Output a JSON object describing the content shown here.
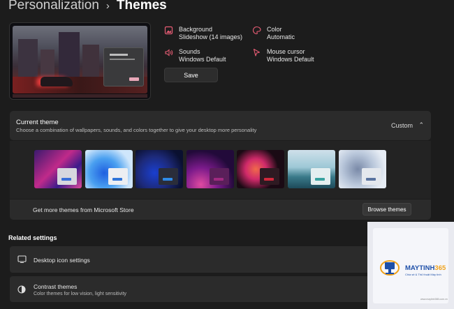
{
  "breadcrumb": {
    "parent": "Personalization",
    "separator": "›",
    "current": "Themes"
  },
  "properties": {
    "background": {
      "label": "Background",
      "value": "Slideshow (14 images)",
      "icon": "image-icon"
    },
    "color": {
      "label": "Color",
      "value": "Automatic",
      "icon": "palette-icon"
    },
    "sounds": {
      "label": "Sounds",
      "value": "Windows Default",
      "icon": "speaker-icon"
    },
    "mouse_cursor": {
      "label": "Mouse cursor",
      "value": "Windows Default",
      "icon": "cursor-icon"
    }
  },
  "save_label": "Save",
  "current_theme": {
    "title": "Current theme",
    "subtitle": "Choose a combination of wallpapers, sounds, and colors together to give your desktop more personality",
    "value": "Custom",
    "themes": [
      {
        "bg": "linear-gradient(135deg,#3a1a6e,#c02a8a 45%,#3b1b8a 70%,#e04a9a)",
        "win": "#d7d7de",
        "btn": "#3a6fd8"
      },
      {
        "bg": "radial-gradient(circle at 40% 60%,#1f5fe0,#4aa0f0 40%,#cfe6fb 75%)",
        "win": "#eceef2",
        "btn": "#2f74d8"
      },
      {
        "bg": "radial-gradient(circle at 40% 60%,#1a3fd0,#1d2a7a 45%,#0a1030 80%)",
        "win": "#2a2d3a",
        "btn": "#2f8ae8"
      },
      {
        "bg": "radial-gradient(circle at 30% 90%,#e04aa0,#7a1a8a 35%,#220a3a 70%)",
        "win": "#5a1f5a",
        "btn": "#a02a80"
      },
      {
        "bg": "radial-gradient(circle at 40% 50%,#f06a4a,#d02a6a 30%,#1a0a14 65%)",
        "win": "#2e1a22",
        "btn": "#d0283c"
      },
      {
        "bg": "linear-gradient(180deg,#cfe0ea,#9ec8d6 45%,#3a7a8a 70%,#1e4a5a)",
        "win": "#e4eef0",
        "btn": "#3aa2a0"
      },
      {
        "bg": "radial-gradient(circle at 40% 50%,#7a8aa8,#b8c6da 45%,#e6ecf4 80%)",
        "win": "#e4e8ee",
        "btn": "#5a74a0"
      }
    ]
  },
  "store": {
    "text": "Get more themes from Microsoft Store",
    "button": "Browse themes"
  },
  "related_settings": {
    "heading": "Related settings",
    "desktop_icon": {
      "title": "Desktop icon settings"
    },
    "contrast": {
      "title": "Contrast themes",
      "subtitle": "Color themes for low vision, light sensitivity"
    }
  },
  "watermark": {
    "brand_main": "MAYTINH",
    "brand_num": "365",
    "tagline": "Chia sẻ & Thủ thuật Máy tính",
    "url": "www.maytinh365.com.vn"
  },
  "colors": {
    "accent": "#e75c74",
    "card": "#2b2b2b",
    "background": "#1c1c1c"
  }
}
